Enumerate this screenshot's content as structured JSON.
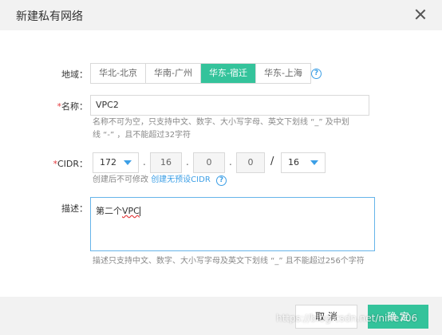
{
  "dialog": {
    "title": "新建私有网络"
  },
  "region": {
    "label": "地域：",
    "options": [
      "华北-北京",
      "华南-广州",
      "华东-宿迁",
      "华东-上海"
    ],
    "selected": "华东-宿迁",
    "help_glyph": "?"
  },
  "name": {
    "required_mark": "*",
    "label": "名称：",
    "value": "VPC2",
    "hint_line1": "名称不可为空，只支持中文、数字、大小写字母、英文下划线 “_” 及中划",
    "hint_line2": "线 “-” ，且不能超过32字符"
  },
  "cidr": {
    "required_mark": "*",
    "label": "CIDR：",
    "octet1": "172",
    "octet2": "16",
    "octet3": "0",
    "octet4": "0",
    "separator": ".",
    "slash": "/",
    "mask": "16",
    "hint": "创建后不可修改",
    "link": "创建无预设CIDR",
    "help_glyph": "?"
  },
  "description": {
    "label": "描述：",
    "value_prefix": "第二个",
    "value_marked": "VPC",
    "hint": "描述只支持中文、数字、大小写字母及英文下划线 “_” 且不能超过256个字符"
  },
  "footer": {
    "cancel_label": "取 消",
    "ok_label": "确 定"
  },
  "watermark": "https://blog.csdn.net/nine706",
  "colors": {
    "accent": "#34c39b",
    "link": "#3c9fe6",
    "required": "#e4393c"
  },
  "icons": {
    "close": "close-icon",
    "help": "help-icon",
    "dropdown": "chevron-down-icon"
  }
}
